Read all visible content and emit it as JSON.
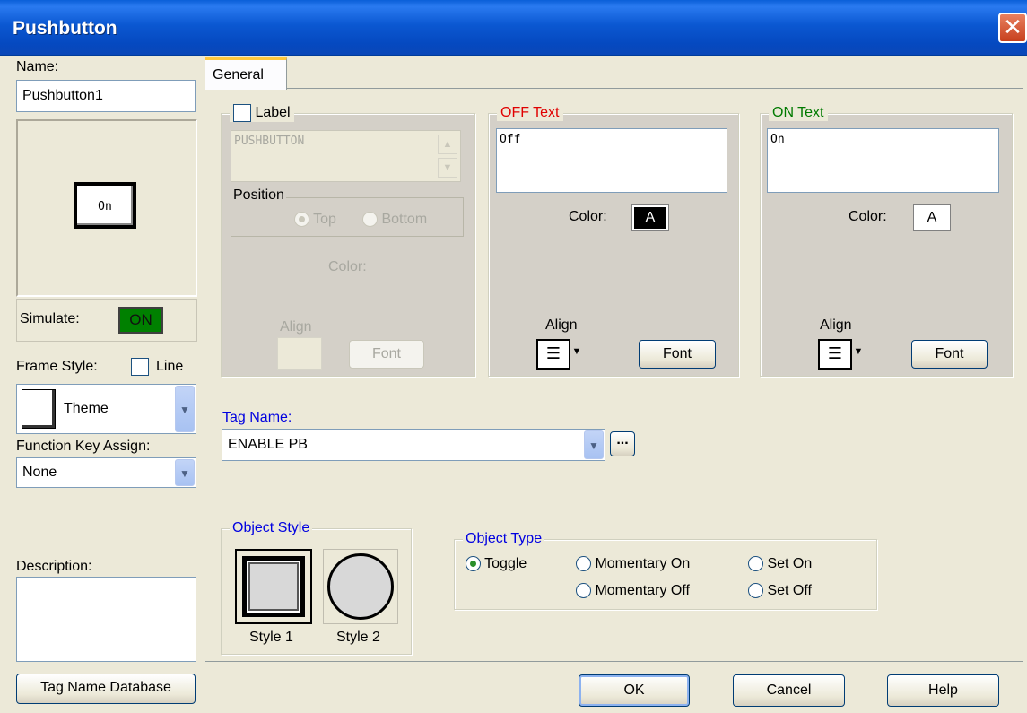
{
  "window": {
    "title": "Pushbutton",
    "close_glyph": "✕"
  },
  "left": {
    "name_label": "Name:",
    "name_value": "Pushbutton1",
    "preview_text": "On",
    "simulate_label": "Simulate:",
    "simulate_value": "ON",
    "frame_style_label": "Frame Style:",
    "line_label": "Line",
    "frame_style_value": "Theme",
    "function_key_label": "Function Key Assign:",
    "function_key_value": "None",
    "description_label": "Description:",
    "description_value": "",
    "tag_db_button": "Tag Name Database"
  },
  "tabs": [
    {
      "label": "General"
    }
  ],
  "label_group": {
    "title": "Label",
    "text": "PUSHBUTTON",
    "position_title": "Position",
    "top": "Top",
    "bottom": "Bottom",
    "color_label": "Color:",
    "align_label": "Align",
    "font_button": "Font"
  },
  "off_text": {
    "title": "OFF Text",
    "value": "Off",
    "color_label": "Color:",
    "color_swatch": "A",
    "align_label": "Align",
    "font_button": "Font"
  },
  "on_text": {
    "title": "ON Text",
    "value": "On",
    "color_label": "Color:",
    "color_swatch": "A",
    "align_label": "Align",
    "font_button": "Font"
  },
  "tag": {
    "label": "Tag Name:",
    "value": "ENABLE PB",
    "browse": "..."
  },
  "object_style": {
    "title": "Object Style",
    "style1": "Style 1",
    "style2": "Style 2"
  },
  "object_type": {
    "title": "Object Type",
    "options": {
      "toggle": "Toggle",
      "momentary_on": "Momentary On",
      "momentary_off": "Momentary Off",
      "set_on": "Set On",
      "set_off": "Set Off"
    },
    "selected": "Toggle"
  },
  "footer": {
    "ok": "OK",
    "cancel": "Cancel",
    "help": "Help"
  },
  "colors": {
    "title_bar": "#0b58d2",
    "window_bg": "#ece9d8",
    "simulate_on": "#008000",
    "off_text_title": "#e00000",
    "on_text_title": "#007a00",
    "link_blue": "#0000e0"
  }
}
